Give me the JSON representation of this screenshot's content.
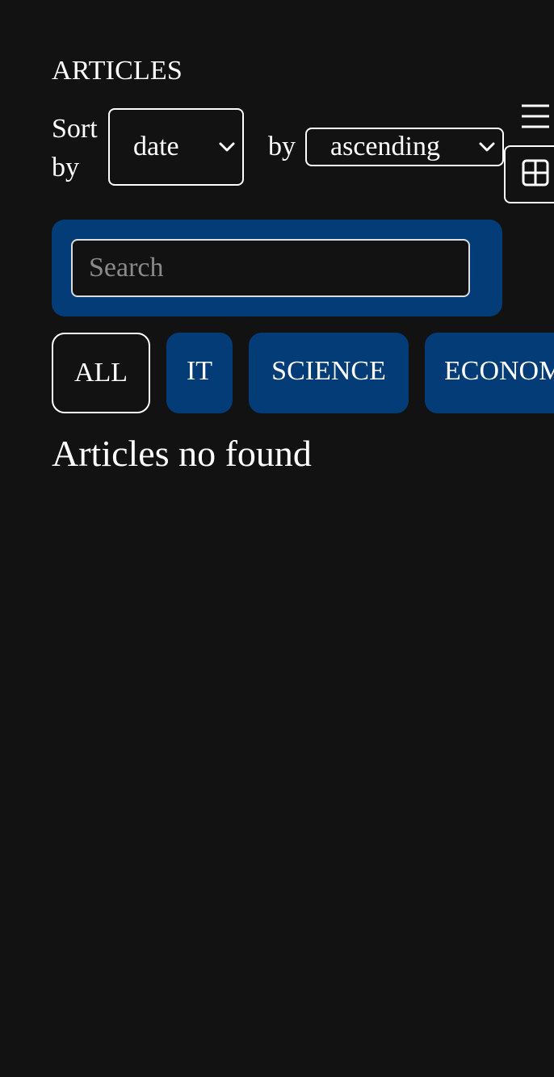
{
  "header": {
    "title": "ARTICLES"
  },
  "sort": {
    "label": "Sort by",
    "field_value": "date",
    "order_label": "by",
    "order_value": "ascending"
  },
  "view": {
    "list_icon": "hamburger-list-icon",
    "tile_icon": "grid-tile-icon"
  },
  "search": {
    "placeholder": "Search",
    "value": ""
  },
  "tabs": [
    {
      "label": "ALL",
      "selected": true
    },
    {
      "label": "IT",
      "selected": false
    },
    {
      "label": "SCIENCE",
      "selected": false
    },
    {
      "label": "ECONOMICS",
      "selected": false
    }
  ],
  "content": {
    "empty_message": "Articles no found"
  },
  "colors": {
    "background": "#121212",
    "accent": "#043c78",
    "text": "#ffffff",
    "placeholder": "#8a8a8a"
  }
}
